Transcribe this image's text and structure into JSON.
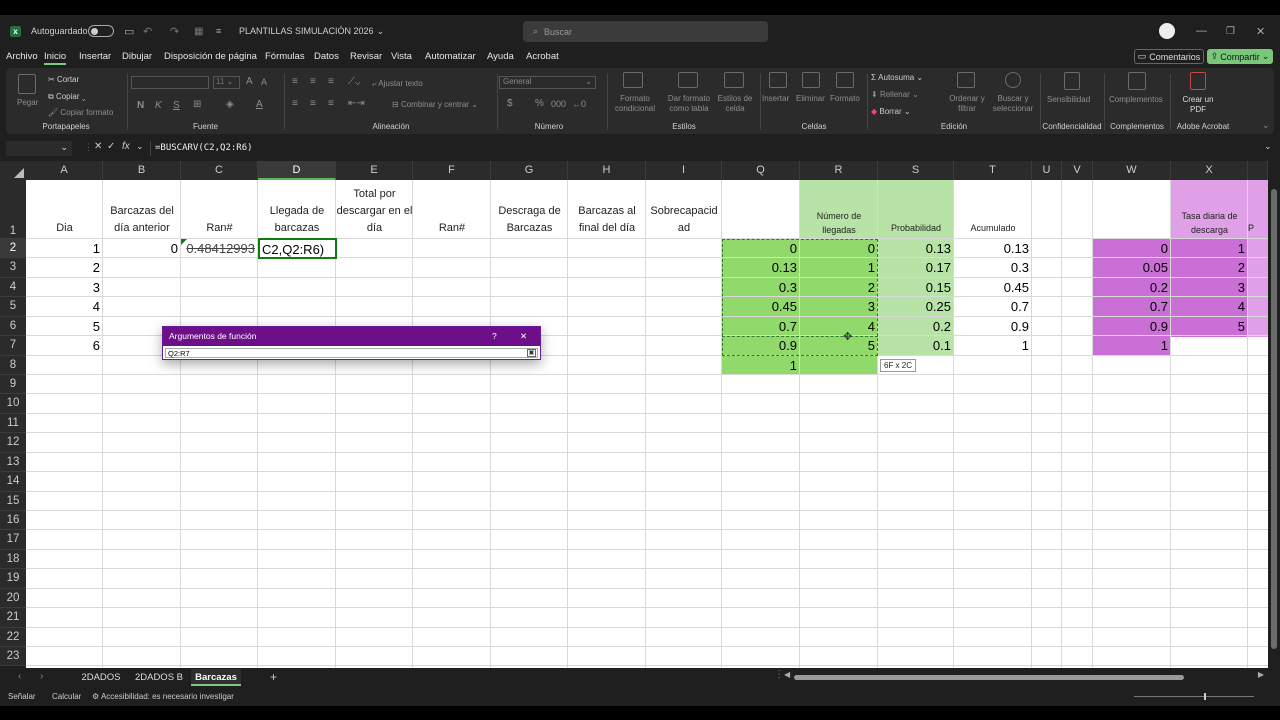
{
  "titlebar": {
    "autosave": "Autoguardado",
    "filename": "PLANTILLAS SIMULACIÓN 2026",
    "search_placeholder": "Buscar"
  },
  "menu": [
    "Archivo",
    "Inicio",
    "Insertar",
    "Dibujar",
    "Disposición de página",
    "Fórmulas",
    "Datos",
    "Revisar",
    "Vista",
    "Automatizar",
    "Ayuda",
    "Acrobat"
  ],
  "comments_button": "Comentarios",
  "share_button": "Compartir",
  "ribbon": {
    "clipboard": {
      "paste": "Pegar",
      "cut": "Cortar",
      "copy": "Copiar",
      "format_painter": "Copiar formato",
      "title": "Portapapeles"
    },
    "font": {
      "title": "Fuente",
      "bold": "N",
      "italic": "K",
      "underline": "S"
    },
    "alignment": {
      "wrap": "Ajustar texto",
      "merge": "Combinar y centrar",
      "title": "Alineación"
    },
    "number": {
      "format": "General",
      "title": "Número",
      "currency": "$",
      "percent": "%"
    },
    "styles": {
      "conditional": "Formato condicional",
      "as_table": "Dar formato como tabla",
      "cell_styles": "Estilos de celda",
      "title": "Estilos"
    },
    "cells": {
      "insert": "Insertar",
      "delete": "Eliminar",
      "format": "Formato",
      "title": "Celdas"
    },
    "editing": {
      "autosum": "Autosuma",
      "fill": "Rellenar",
      "clear": "Borrar",
      "sort": "Ordenar y filtrar",
      "find": "Buscar y seleccionar",
      "title": "Edición"
    },
    "sensitivity": {
      "label": "Sensibilidad",
      "title": "Confidencialidad"
    },
    "addins": {
      "label": "Complementos",
      "title": "Complementos"
    },
    "acrobat": {
      "label": "Crear un PDF",
      "title": "Adobe Acrobat"
    }
  },
  "formula_bar": {
    "fx": "fx",
    "formula": "=BUSCARV(C2,Q2:R6)"
  },
  "columns": [
    "A",
    "B",
    "C",
    "D",
    "E",
    "F",
    "G",
    "H",
    "I",
    "Q",
    "R",
    "S",
    "T",
    "U",
    "V",
    "W",
    "X"
  ],
  "rows": [
    "1",
    "2",
    "3",
    "4",
    "5",
    "6",
    "7",
    "8",
    "9",
    "10",
    "11",
    "12",
    "13",
    "14",
    "15",
    "16",
    "17",
    "18",
    "19",
    "20",
    "21",
    "22",
    "23"
  ],
  "headers": {
    "A": "Dia",
    "B": "Barcazas del día anterior",
    "C": "Ran#",
    "D": "Llegada de barcazas",
    "E": "Total por descargar en el día",
    "F": "Ran#",
    "G": "Descraga de Barcazas",
    "H": "Barcazas al final del día",
    "I": "Sobrecapacid ad",
    "R": "Número de llegadas",
    "S": "Probabilidad",
    "T": "Acumulado",
    "X": "Tasa diaria de descarga",
    "Y": "P"
  },
  "col_a": [
    "1",
    "2",
    "3",
    "4",
    "5",
    "6"
  ],
  "b2": "0",
  "c2": "0.48412993",
  "d2": "C2,Q2:R6)",
  "table_q": [
    "0",
    "0.13",
    "0.3",
    "0.45",
    "0.7",
    "0.9",
    "1"
  ],
  "table_r": [
    "0",
    "1",
    "2",
    "3",
    "4",
    "5"
  ],
  "table_s": [
    "0.13",
    "0.17",
    "0.15",
    "0.25",
    "0.2",
    "0.1"
  ],
  "table_t": [
    "0.13",
    "0.3",
    "0.45",
    "0.7",
    "0.9",
    "1"
  ],
  "table_w": [
    "0",
    "0.05",
    "0.2",
    "0.7",
    "0.9",
    "1"
  ],
  "table_x": [
    "1",
    "2",
    "3",
    "4",
    "5"
  ],
  "range_tooltip": "6F x 2C",
  "dialog": {
    "title": "Argumentos de función",
    "help": "?",
    "close": "✕",
    "input": "Q2:R7"
  },
  "sheets": [
    "2DADOS",
    "2DADOS B",
    "Barcazas"
  ],
  "status": {
    "ready": "Señalar",
    "calc": "Calcular",
    "accessibility": "Accesibilidad: es necesario investigar"
  },
  "colors": {
    "green_header": "#b7e4a6",
    "green_table": "#92d96b",
    "purple_table": "#c96fd6",
    "purple_header": "#dfa0e8",
    "accent": "#6e0f8a"
  }
}
